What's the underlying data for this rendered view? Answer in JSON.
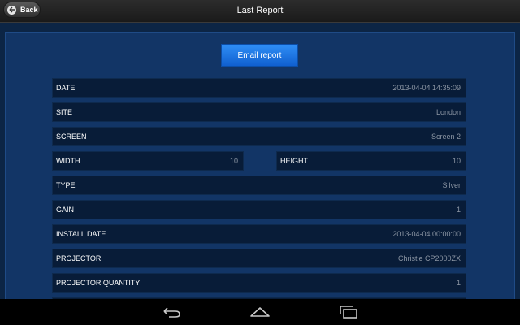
{
  "header": {
    "back_label": "Back",
    "title": "Last Report"
  },
  "actions": {
    "email_label": "Email report"
  },
  "rows": [
    {
      "label": "DATE",
      "value": "2013-04-04 14:35:09"
    },
    {
      "label": "SITE",
      "value": "London"
    },
    {
      "label": "SCREEN",
      "value": "Screen 2"
    },
    {
      "label": "WIDTH",
      "value": "10"
    },
    {
      "label": "HEIGHT",
      "value": "10"
    },
    {
      "label": "TYPE",
      "value": "Silver"
    },
    {
      "label": "GAIN",
      "value": "1"
    },
    {
      "label": "INSTALL DATE",
      "value": "2013-04-04 00:00:00"
    },
    {
      "label": "PROJECTOR",
      "value": "Christie CP2000ZX"
    },
    {
      "label": "PROJECTOR QUANTITY",
      "value": "1"
    }
  ],
  "icons": {
    "back": "back-arrow-icon",
    "nav_back": "nav-back-icon",
    "nav_home": "nav-home-icon",
    "nav_recents": "nav-recents-icon"
  }
}
